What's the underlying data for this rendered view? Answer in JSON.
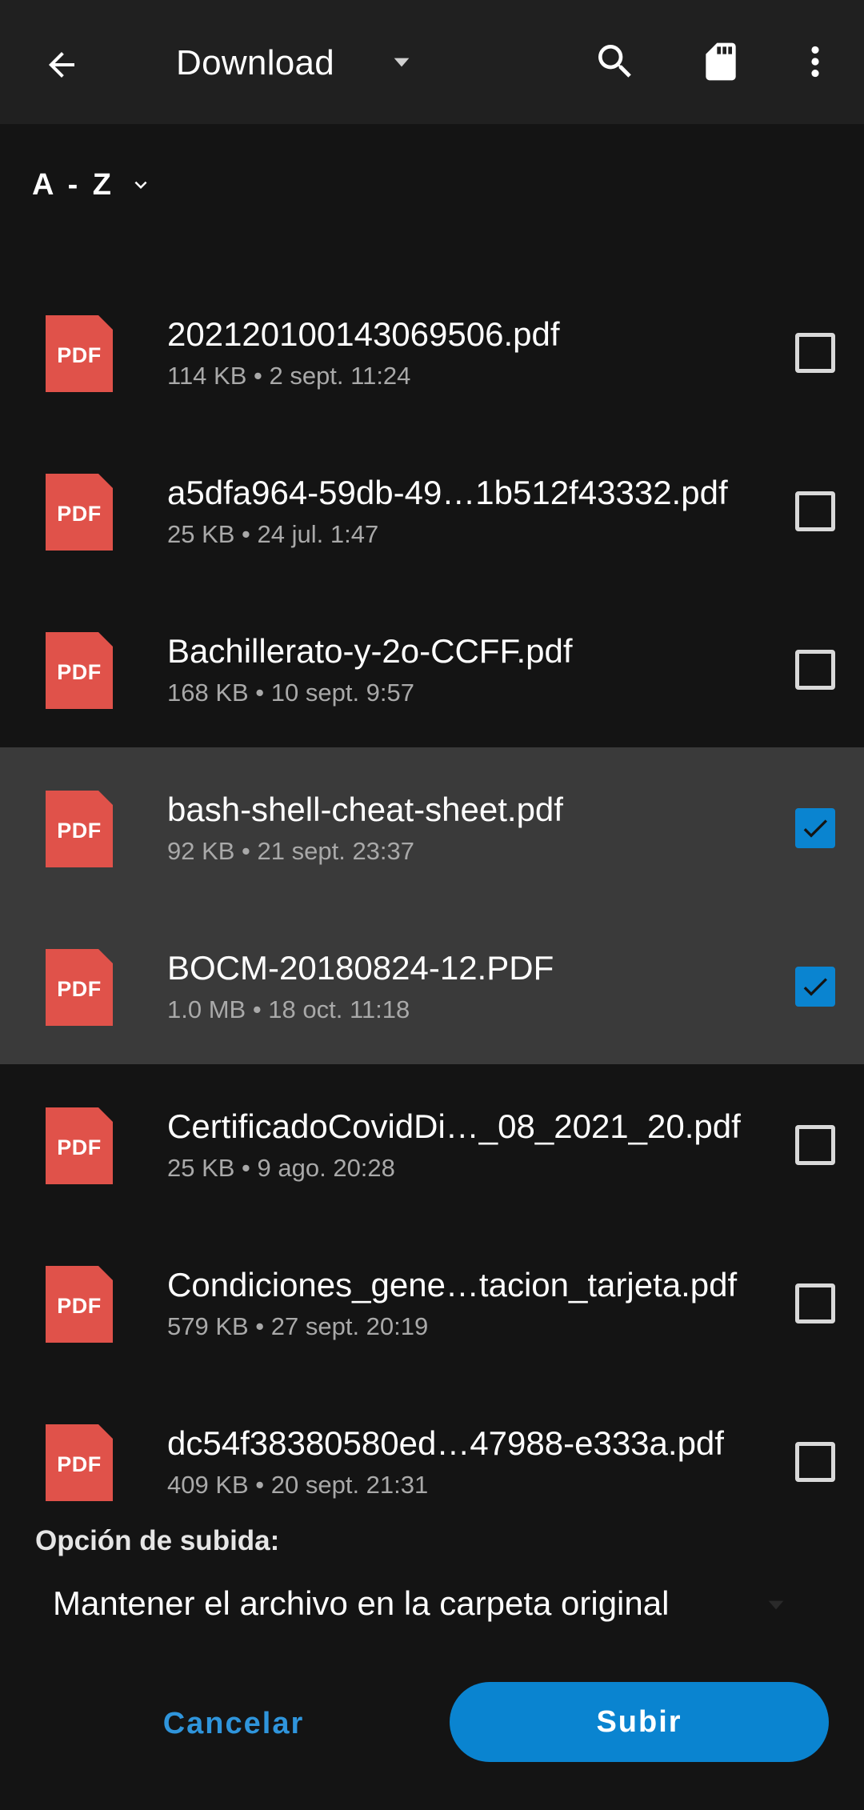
{
  "appbar": {
    "title": "Download",
    "back_icon": "arrow-left-icon",
    "dropdown_icon": "caret-down-icon",
    "search_icon": "search-icon",
    "storage_icon": "sd-card-icon",
    "more_icon": "more-vert-icon"
  },
  "sort": {
    "label": "A - Z",
    "icon": "chevron-down-icon"
  },
  "files": [
    {
      "name": "20212010014306950 6.pdf",
      "meta": "114 KB • 2 sept. 11:24",
      "checked": false
    },
    {
      "name": "a5dfa964-59db-49…1b512f43332.pdf",
      "meta": "25 KB • 24 jul. 1:47",
      "checked": false
    },
    {
      "name": "Bachillerato-y-2o-CCFF.pdf",
      "meta": "168 KB • 10 sept. 9:57",
      "checked": false
    },
    {
      "name": "bash-shell-cheat-sheet.pdf",
      "meta": "92 KB • 21 sept. 23:37",
      "checked": true
    },
    {
      "name": "BOCM-20180824-12.PDF",
      "meta": "1.0 MB • 18 oct. 11:18",
      "checked": true
    },
    {
      "name": "CertificadoCovidDi…_08_2021_20.pdf",
      "meta": "25 KB • 9 ago. 20:28",
      "checked": false
    },
    {
      "name": "Condiciones_gene…tacion_tarjeta.pdf",
      "meta": "579 KB • 27 sept. 20:19",
      "checked": false
    },
    {
      "name": "dc54f38380580ed…47988-e333a.pdf",
      "meta": "409 KB • 20 sept. 21:31",
      "checked": false
    }
  ],
  "file_icon_text": "PDF",
  "upload": {
    "label": "Opción de subida:",
    "selected_option": "Mantener el archivo en la carpeta original"
  },
  "buttons": {
    "cancel": "Cancelar",
    "upload": "Subir"
  },
  "colors": {
    "accent": "#0a84d0",
    "pdf_red": "#e0524a",
    "selected_row": "#3a3a3a"
  }
}
